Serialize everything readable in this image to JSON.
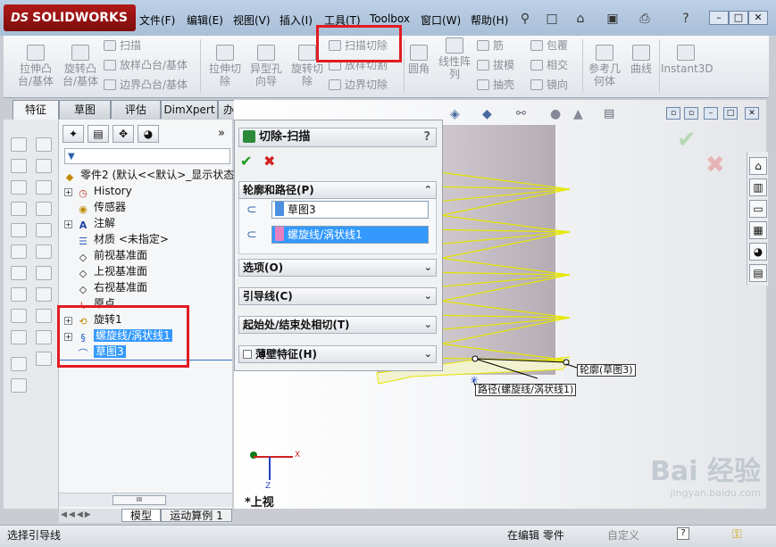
{
  "app": {
    "logo_text": "SOLIDWORKS",
    "logo_prefix": "DS"
  },
  "menu": [
    "文件(F)",
    "编辑(E)",
    "视图(V)",
    "插入(I)",
    "工具(T)",
    "Toolbox",
    "窗口(W)",
    "帮助(H)"
  ],
  "commands": {
    "extrude_boss": "拉伸凸台/基体",
    "revolve_boss": "旋转凸台/基体",
    "sweep": "扫描",
    "loft_boss": "放样凸台/基体",
    "boundary_boss": "边界凸台/基体",
    "extrude_cut": "拉伸切除",
    "hole_wizard": "异型孔向导",
    "revolve_cut": "旋转切除",
    "swept_cut": "扫描切除",
    "lofted_cut": "放样切割",
    "boundary_cut": "边界切除",
    "fillet": "圆角",
    "linear_pattern": "线性阵列",
    "rib": "筋",
    "draft": "拔模",
    "shell": "抽壳",
    "wrap": "包覆",
    "intersect": "相交",
    "mirror": "镜向",
    "ref_geometry": "参考几何体",
    "curves": "曲线",
    "instant3d": "Instant3D"
  },
  "tabs": [
    "特征",
    "草图",
    "评估",
    "DimXpert",
    "办公室产品"
  ],
  "tree": {
    "root": "零件2 (默认<<默认>_显示状态",
    "items": [
      "History",
      "传感器",
      "注解",
      "材质 <未指定>",
      "前视基准面",
      "上视基准面",
      "右视基准面",
      "原点",
      "旋转1",
      "螺旋线/涡状线1",
      "草图3"
    ]
  },
  "bottom_tabs": [
    "模型",
    "运动算例 1"
  ],
  "scroll_glyph": "III",
  "propmgr": {
    "title": "切除-扫描",
    "help": "?",
    "ok": "✔",
    "cancel": "✖",
    "profile_path_group": "轮廓和路径(P)",
    "profile_value": "草图3",
    "path_value": "螺旋线/涡状线1",
    "options_group": "选项(O)",
    "guide_group": "引导线(C)",
    "tangency_group": "起始处/结束处相切(T)",
    "thin_group": "薄壁特征(H)"
  },
  "callouts": {
    "profile": "轮廓(草图3)",
    "path": "路径(螺旋线/涡状线1)"
  },
  "view_label": "*上视",
  "axes": {
    "x": "X",
    "z": "Z"
  },
  "status": {
    "left": "选择引导线",
    "mid": "在编辑 零件",
    "right": "自定义"
  },
  "watermark": {
    "line1": "Bai 经验",
    "line2": "jingyan.baidu.com"
  },
  "colors": {
    "highlight": "#e11b22",
    "selection": "#3399ff",
    "helix": "#e6e600"
  }
}
